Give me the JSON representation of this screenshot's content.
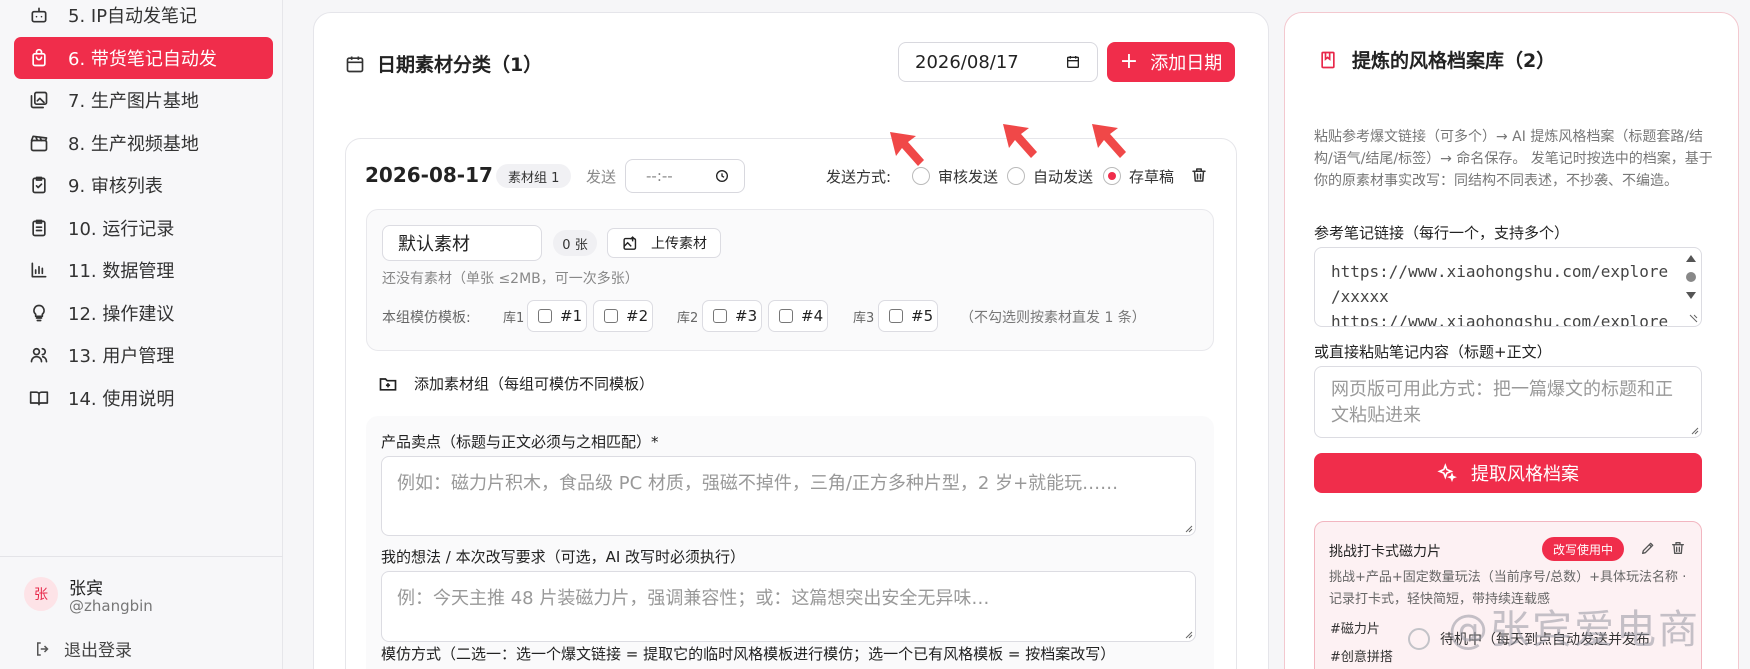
{
  "sidebar": {
    "items": [
      {
        "label": "5. IP自动发笔记",
        "icon": "bot-icon",
        "active": false
      },
      {
        "label": "6. 带货笔记自动发",
        "icon": "bag-icon",
        "active": true
      },
      {
        "label": "7. 生产图片基地",
        "icon": "images-icon",
        "active": false
      },
      {
        "label": "8. 生产视频基地",
        "icon": "clapper-icon",
        "active": false
      },
      {
        "label": "9. 审核列表",
        "icon": "clipboard-check-icon",
        "active": false
      },
      {
        "label": "10. 运行记录",
        "icon": "clipboard-list-icon",
        "active": false
      },
      {
        "label": "11. 数据管理",
        "icon": "bar-chart-icon",
        "active": false
      },
      {
        "label": "12. 操作建议",
        "icon": "lightbulb-icon",
        "active": false
      },
      {
        "label": "13. 用户管理",
        "icon": "users-icon",
        "active": false
      },
      {
        "label": "14. 使用说明",
        "icon": "book-icon",
        "active": false
      }
    ],
    "user": {
      "avatar": "张",
      "name": "张宾",
      "handle": "@zhangbin"
    },
    "logout_label": "退出登录"
  },
  "main": {
    "title": "日期素材分类（1）",
    "date_value": "2026/08/17",
    "add_date_label": "添加日期",
    "block": {
      "date": "2026-08-17",
      "badge": "素材组 1",
      "send_label": "发送",
      "time_placeholder": "--:--",
      "send_mode_label": "发送方式:",
      "modes": [
        {
          "label": "审核发送",
          "checked": false
        },
        {
          "label": "自动发送",
          "checked": false
        },
        {
          "label": "存草稿",
          "checked": true
        }
      ],
      "group": {
        "name": "默认素材",
        "count": "0 张",
        "upload_label": "上传素材",
        "empty_hint": "还没有素材（单张 ≤2MB，可一次多张）",
        "template_label": "本组模仿模板:",
        "libs": [
          "库1",
          "库2",
          "库3"
        ],
        "templates": [
          "#1",
          "#2",
          "#3",
          "#4",
          "#5"
        ],
        "template_note": "（不勾选则按素材直发 1 条）"
      },
      "add_group_label": "添加素材组（每组可模仿不同模板）",
      "fields": {
        "selling_label": "产品卖点（标题与正文必须与之相匹配）*",
        "selling_placeholder": "例如：磁力片积木，食品级 PC 材质，强磁不掉件，三角/正方多种片型，2 岁+就能玩……",
        "idea_label": "我的想法 / 本次改写要求（可选，AI 改写时必须执行）",
        "idea_placeholder": "例：今天主推 48 片装磁力片，强调兼容性；或：这篇想突出安全无异味…",
        "imitate_label": "模仿方式（二选一：选一个爆文链接 = 提取它的临时风格模板进行模仿；选一个已有风格模板 = 按档案改写）"
      }
    }
  },
  "right": {
    "title": "提炼的风格档案库（2）",
    "description": "粘贴参考爆文链接（可多个）→ AI 提炼风格档案（标题套路/结构/语气/结尾/标签）→ 命名保存。 发笔记时按选中的档案，基于你的原素材事实改写：同结构不同表述，不抄袭、不编造。",
    "url_label": "参考笔记链接（每行一个，支持多个）",
    "url_lines": [
      "https://www.xiaohongshu.com/explore",
      "/xxxxx",
      "https://www.xiaohongshu.com/explore"
    ],
    "paste_label": "或直接粘贴笔记内容（标题+正文）",
    "paste_placeholder": "网页版可用此方式：把一篇爆文的标题和正文粘贴进来",
    "extract_label": "提取风格档案",
    "archive": {
      "title": "挑战打卡式磁力片",
      "badge": "改写使用中",
      "desc": "挑战+产品+固定数量玩法（当前序号/总数）+具体玩法名称 · 记录打卡式，轻快简短，带持续连载感",
      "tags": [
        "#磁力片",
        "#创意拼搭"
      ],
      "status": "待机中（每天到点自动发送并发布"
    }
  },
  "watermark": "@张宾爱电商",
  "colors": {
    "accent": "#f02d4b",
    "accent_light": "#fde3e7"
  }
}
